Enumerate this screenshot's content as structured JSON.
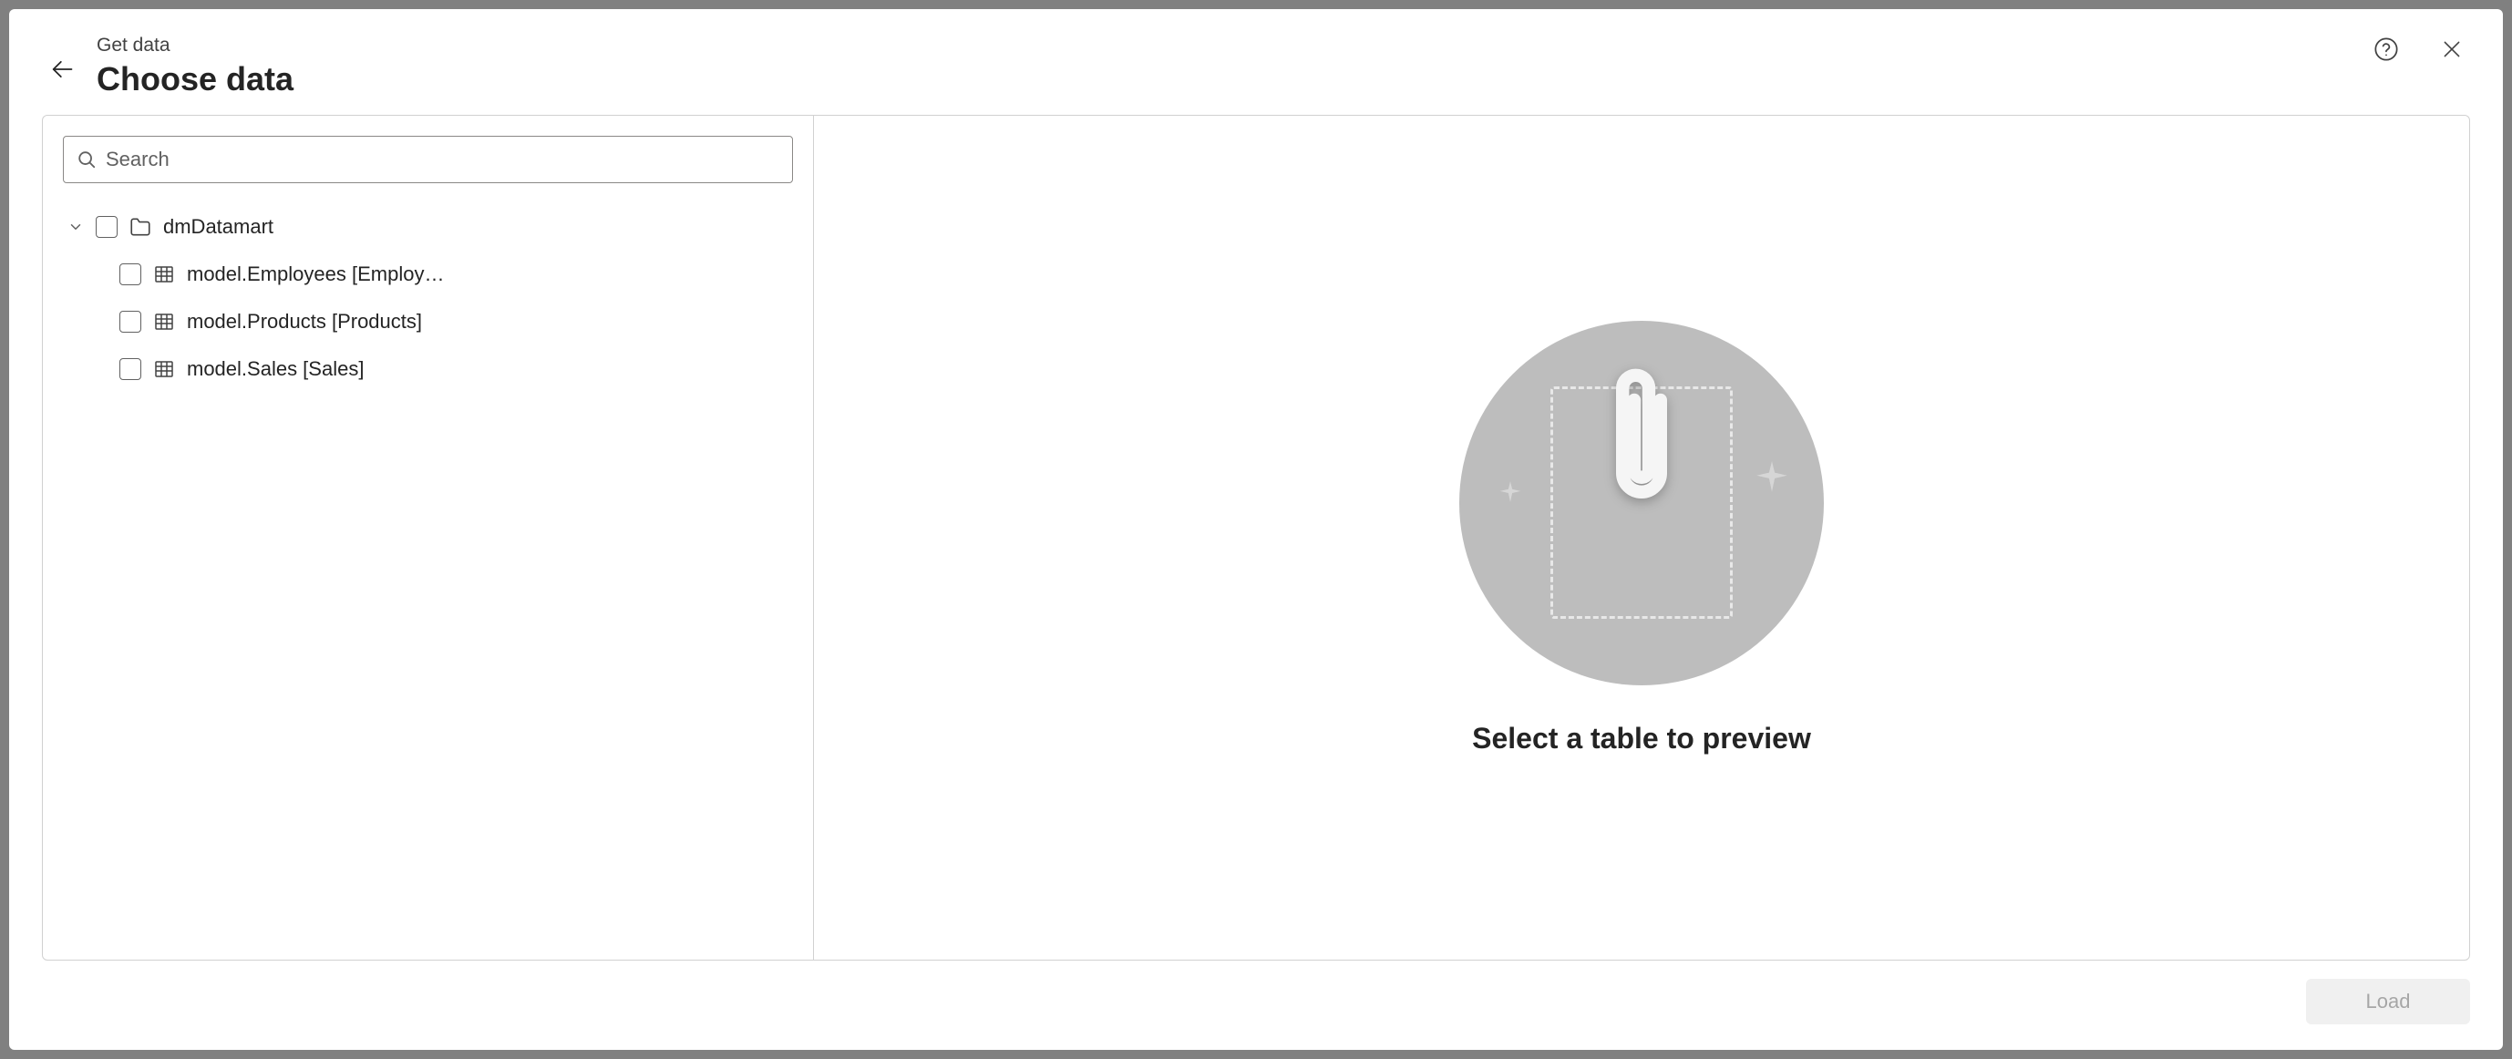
{
  "header": {
    "breadcrumb": "Get data",
    "title": "Choose data"
  },
  "search": {
    "placeholder": "Search",
    "value": ""
  },
  "tree": {
    "root": {
      "label": "dmDatamart",
      "expanded": true,
      "checked": false
    },
    "items": [
      {
        "label": "model.Employees [Employ…",
        "checked": false
      },
      {
        "label": "model.Products [Products]",
        "checked": false
      },
      {
        "label": "model.Sales [Sales]",
        "checked": false
      }
    ]
  },
  "preview": {
    "empty_message": "Select a table to preview"
  },
  "footer": {
    "load_label": "Load",
    "load_enabled": false
  }
}
